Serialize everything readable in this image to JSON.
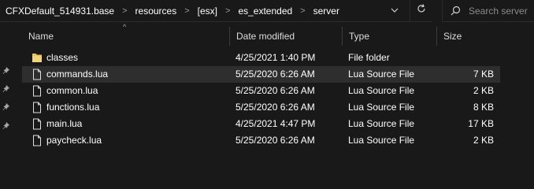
{
  "address": {
    "crumbs": [
      "CFXDefault_514931.base",
      "resources",
      "[esx]",
      "es_extended",
      "server"
    ],
    "separator": ">"
  },
  "search": {
    "placeholder": "Search server"
  },
  "columns": {
    "name": "Name",
    "date": "Date modified",
    "type": "Type",
    "size": "Size"
  },
  "files": [
    {
      "name": "classes",
      "date": "4/25/2021 1:40 PM",
      "type": "File folder",
      "size": "",
      "icon": "folder-icon"
    },
    {
      "name": "commands.lua",
      "date": "5/25/2020 6:26 AM",
      "type": "Lua Source File",
      "size": "7 KB",
      "icon": "file-icon"
    },
    {
      "name": "common.lua",
      "date": "5/25/2020 6:26 AM",
      "type": "Lua Source File",
      "size": "2 KB",
      "icon": "file-icon"
    },
    {
      "name": "functions.lua",
      "date": "5/25/2020 6:26 AM",
      "type": "Lua Source File",
      "size": "8 KB",
      "icon": "file-icon"
    },
    {
      "name": "main.lua",
      "date": "4/25/2021 4:47 PM",
      "type": "Lua Source File",
      "size": "17 KB",
      "icon": "file-icon"
    },
    {
      "name": "paycheck.lua",
      "date": "5/25/2020 6:26 AM",
      "type": "Lua Source File",
      "size": "2 KB",
      "icon": "file-icon"
    }
  ],
  "colors": {
    "background": "#191919",
    "selected_row": "#2e2e2e",
    "folder": "#e8c45a",
    "text": "#ffffff"
  }
}
